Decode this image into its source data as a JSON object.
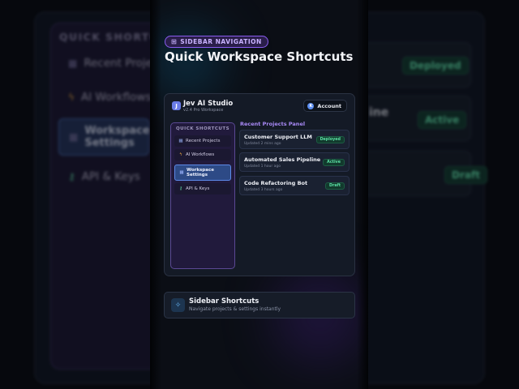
{
  "background": {
    "sidebar_heading": "QUICK SHORTCUTS",
    "nav_items": [
      {
        "icon": "grid-icon",
        "glyph": "▦",
        "label": "Recent Projects"
      },
      {
        "icon": "bolt-icon",
        "glyph": "ϟ",
        "label": "AI Workflows"
      },
      {
        "icon": "gear-icon",
        "glyph": "▦",
        "label": "Workspace Settings"
      },
      {
        "icon": "key-icon",
        "glyph": "⚷",
        "label": "API & Keys"
      }
    ],
    "cards": [
      {
        "title": "",
        "status": "Deployed"
      },
      {
        "title": "ine",
        "status": "Active"
      },
      {
        "title": "",
        "status": "Draft"
      }
    ]
  },
  "header": {
    "eyebrow_icon": "grid-icon",
    "eyebrow": "SIDEBAR NAVIGATION",
    "title": "Quick Workspace Shortcuts"
  },
  "app": {
    "logo_letter": "J",
    "name": "Jev AI Studio",
    "subtitle": "v2.4 Pro Workspace",
    "account_avatar": "K",
    "account_label": "Account",
    "sidebar": {
      "heading": "QUICK SHORTCUTS",
      "items": [
        {
          "icon": "grid-icon",
          "glyph": "▦",
          "label": "Recent Projects",
          "active": false
        },
        {
          "icon": "bolt-icon",
          "glyph": "ϟ",
          "label": "AI Workflows",
          "active": false
        },
        {
          "icon": "gear-icon",
          "glyph": "▦",
          "label": "Workspace Settings",
          "active": true
        },
        {
          "icon": "key-icon",
          "glyph": "⚷",
          "label": "API & Keys",
          "active": false
        }
      ]
    },
    "projects_heading": "Recent Projects Panel",
    "projects": [
      {
        "name": "Customer Support LLM",
        "updated": "Updated 2 mins ago",
        "status": "Deployed"
      },
      {
        "name": "Automated Sales Pipeline",
        "updated": "Updated 1 hour ago",
        "status": "Active"
      },
      {
        "name": "Code Refactoring Bot",
        "updated": "Updated 3 hours ago",
        "status": "Draft"
      }
    ]
  },
  "info_card": {
    "icon": "sparkle-icon",
    "glyph": "✧",
    "title": "Sidebar Shortcuts",
    "subtitle": "Navigate projects & settings instantly"
  },
  "colors": {
    "accent_purple": "#8a5cf0",
    "accent_blue": "#5d8ae8",
    "status_green": "#5be0a4",
    "page_bg": "#0b0e15"
  }
}
